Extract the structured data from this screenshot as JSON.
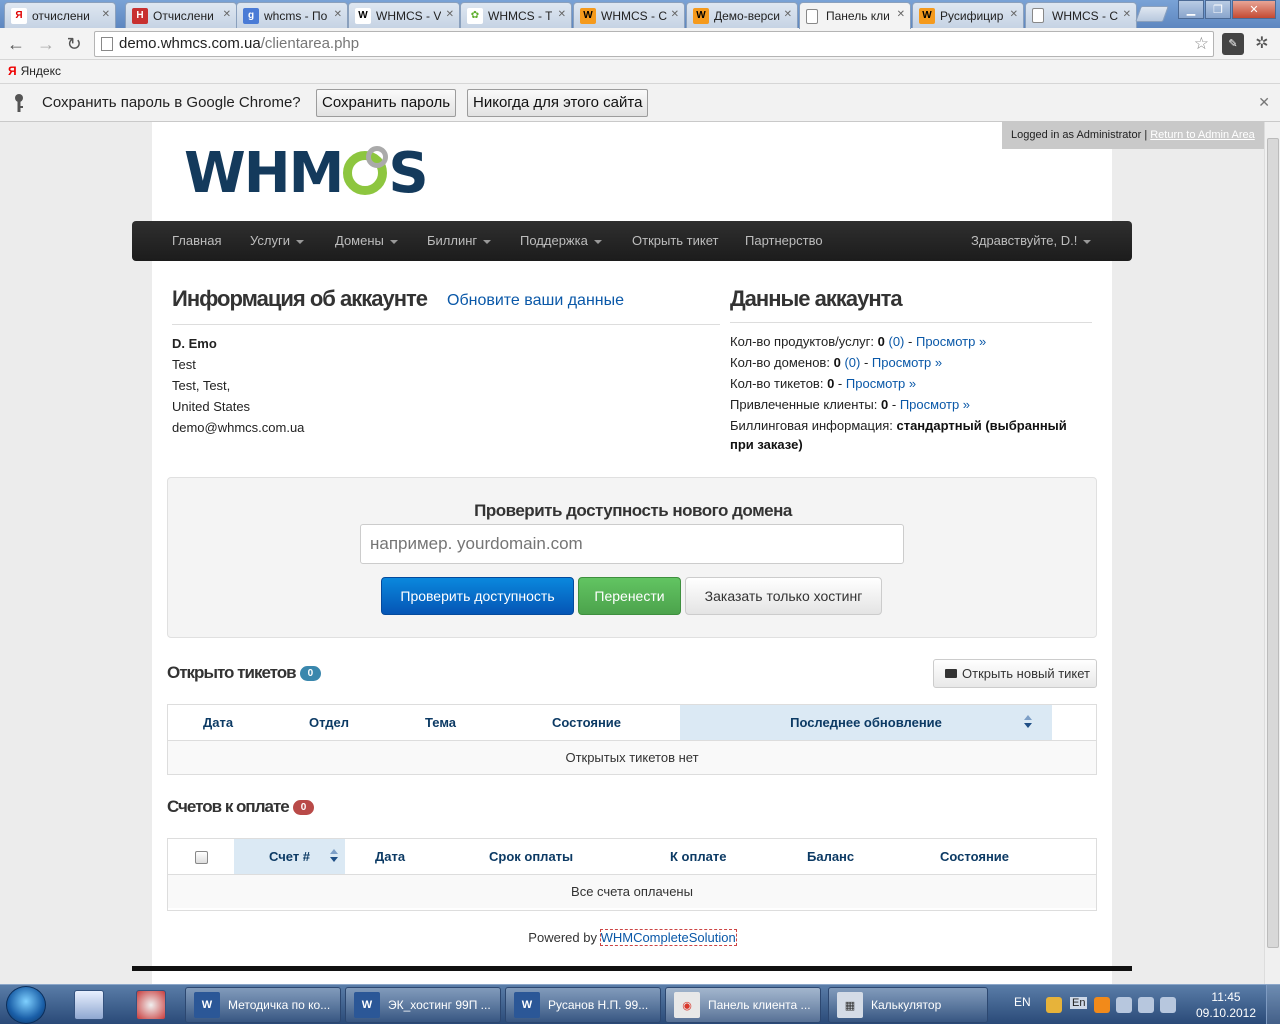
{
  "browser": {
    "tabs": [
      {
        "title": "отчислени",
        "icon": "yandex-icon",
        "fav_text": "Я",
        "fav_color": "#e00000",
        "fav_bg": "#ffffff"
      },
      {
        "title": "Отчислени",
        "icon": "nord-icon",
        "fav_text": "Н",
        "fav_color": "#ffffff",
        "fav_bg": "#c83030"
      },
      {
        "title": "whcms - По",
        "icon": "google-icon",
        "fav_text": "g",
        "fav_color": "#ffffff",
        "fav_bg": "#4a7bd6"
      },
      {
        "title": "WHMCS - V",
        "icon": "wikipedia-icon",
        "fav_text": "W",
        "fav_color": "#000000",
        "fav_bg": "#ffffff"
      },
      {
        "title": "WHMCS - T",
        "icon": "whmcs-gear-icon",
        "fav_text": "✿",
        "fav_color": "#5fae2e",
        "fav_bg": "#ffffff"
      },
      {
        "title": "WHMCS - С",
        "icon": "orange-w-icon",
        "fav_text": "W",
        "fav_color": "#000000",
        "fav_bg": "#f59a1c"
      },
      {
        "title": "Демо-верси",
        "icon": "orange-w-icon",
        "fav_text": "W",
        "fav_color": "#000000",
        "fav_bg": "#f59a1c"
      },
      {
        "title": "Панель кли",
        "icon": "page-icon",
        "fav_text": "",
        "fav_color": "#666666",
        "fav_bg": "#ffffff",
        "active": true
      },
      {
        "title": "Русифицир",
        "icon": "orange-w-icon",
        "fav_text": "W",
        "fav_color": "#000000",
        "fav_bg": "#f59a1c"
      },
      {
        "title": "WHMCS - С",
        "icon": "page-icon",
        "fav_text": "",
        "fav_color": "#666666",
        "fav_bg": "#ffffff"
      }
    ],
    "url_host": "demo.whmcs.com.ua",
    "url_path": "/clientarea.php",
    "bookmark_yandex": "Яндекс",
    "infobar": {
      "message": "Сохранить пароль в Google Chrome?",
      "save_label": "Сохранить пароль",
      "never_label": "Никогда для этого сайта"
    }
  },
  "admin_bar": {
    "text": "Logged in as Administrator",
    "separator": "|",
    "link": "Return to Admin Area"
  },
  "logo": {
    "left": "WHM",
    "right": "S"
  },
  "nav": {
    "home": "Главная",
    "services": "Услуги",
    "domains": "Домены",
    "billing": "Биллинг",
    "support": "Поддержка",
    "open_ticket": "Открыть тикет",
    "affiliates": "Партнерство",
    "greeting": "Здравствуйте, D.!"
  },
  "account_info": {
    "heading": "Информация об аккаунте",
    "update_link": "Обновите ваши данные",
    "name": "D. Emo",
    "company": "Test",
    "address": "Test, Test,",
    "country": "United States",
    "email": "demo@whmcs.com.ua"
  },
  "account_data": {
    "heading": "Данные аккаунта",
    "products_label": "Кол-во продуктов/услуг:",
    "products_count": "0",
    "products_extra": "(0)",
    "domains_label": "Кол-во доменов:",
    "domains_count": "0",
    "domains_extra": "(0)",
    "tickets_label": "Кол-во тикетов:",
    "tickets_count": "0",
    "referrals_label": "Привлеченные клиенты:",
    "referrals_count": "0",
    "view_link": "Просмотр »",
    "dash": "-",
    "billing_label": "Биллинговая информация:",
    "billing_value_1": "стандартный (выбранный",
    "billing_value_2": "при заказе)"
  },
  "domain_check": {
    "title": "Проверить доступность нового домена",
    "placeholder": "например. yourdomain.com",
    "check_label": "Проверить доступность",
    "transfer_label": "Перенести",
    "hosting_label": "Заказать только хостинг"
  },
  "tickets": {
    "heading": "Открыто тикетов",
    "count": "0",
    "badge_color": "#3a87ad",
    "new_ticket_label": "Открыть новый тикет",
    "columns": [
      "Дата",
      "Отдел",
      "Тема",
      "Состояние",
      "Последнее обновление"
    ],
    "empty": "Открытых тикетов нет"
  },
  "invoices": {
    "heading": "Счетов к оплате",
    "count": "0",
    "badge_color": "#b94a48",
    "columns": [
      "Счет #",
      "Дата",
      "Срок оплаты",
      "К оплате",
      "Баланс",
      "Состояние"
    ],
    "empty": "Все счета оплачены"
  },
  "footer": {
    "powered_by": "Powered by",
    "link": "WHMCompleteSolution"
  },
  "taskbar": {
    "tasks": [
      {
        "label": "Методичка по ко...",
        "icon": "word-icon"
      },
      {
        "label": "ЭК_хостинг 99П ...",
        "icon": "word-icon"
      },
      {
        "label": "Русанов Н.П. 99...",
        "icon": "word-icon"
      },
      {
        "label": "Панель клиента ...",
        "icon": "chrome-icon",
        "active": true
      },
      {
        "label": "Калькулятор",
        "icon": "calculator-icon"
      }
    ],
    "lang": "EN",
    "lang2": "En",
    "time": "11:45",
    "date": "09.10.2012"
  }
}
